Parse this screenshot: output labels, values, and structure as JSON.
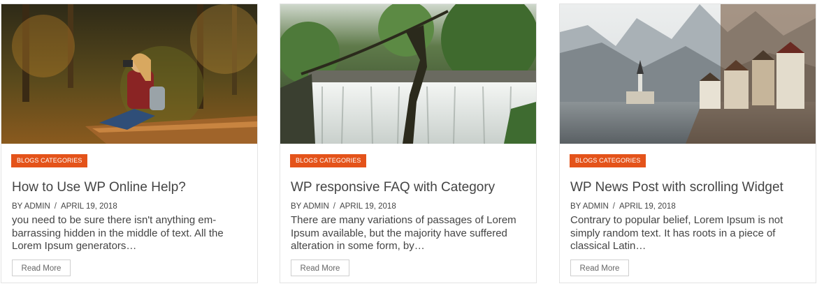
{
  "posts": [
    {
      "image": "woman-photographer-forest-image",
      "category": "BLOGS CATEGORIES",
      "title": "How to Use WP Online Help?",
      "author": "BY ADMIN",
      "separator": "/",
      "date": "APRIL 19, 2018",
      "excerpt": "you need to be sure there isn't anything em­barrassing hidden in the middle of text. All the Lorem Ipsum generators…",
      "read_more": "Read More"
    },
    {
      "image": "waterfall-jungle-image",
      "category": "BLOGS CATEGORIES",
      "title": "WP responsive FAQ with Category",
      "author": "BY ADMIN",
      "separator": "/",
      "date": "APRIL 19, 2018",
      "excerpt": "There are many variations of passages of Lorem Ipsum available, but the majority have suffered alteration in some form, by…",
      "read_more": "Read More"
    },
    {
      "image": "mountain-lake-village-image",
      "category": "BLOGS CATEGORIES",
      "title": "WP News Post with scrolling Widget",
      "author": "BY ADMIN",
      "separator": "/",
      "date": "APRIL 19, 2018",
      "excerpt": "Contrary to popular belief, Lorem Ipsum is not simply random text. It has roots in a piece of classical Latin…",
      "read_more": "Read More"
    }
  ],
  "colors": {
    "badge": "#e4531a",
    "text": "#444444",
    "border": "#e3e3e3"
  }
}
